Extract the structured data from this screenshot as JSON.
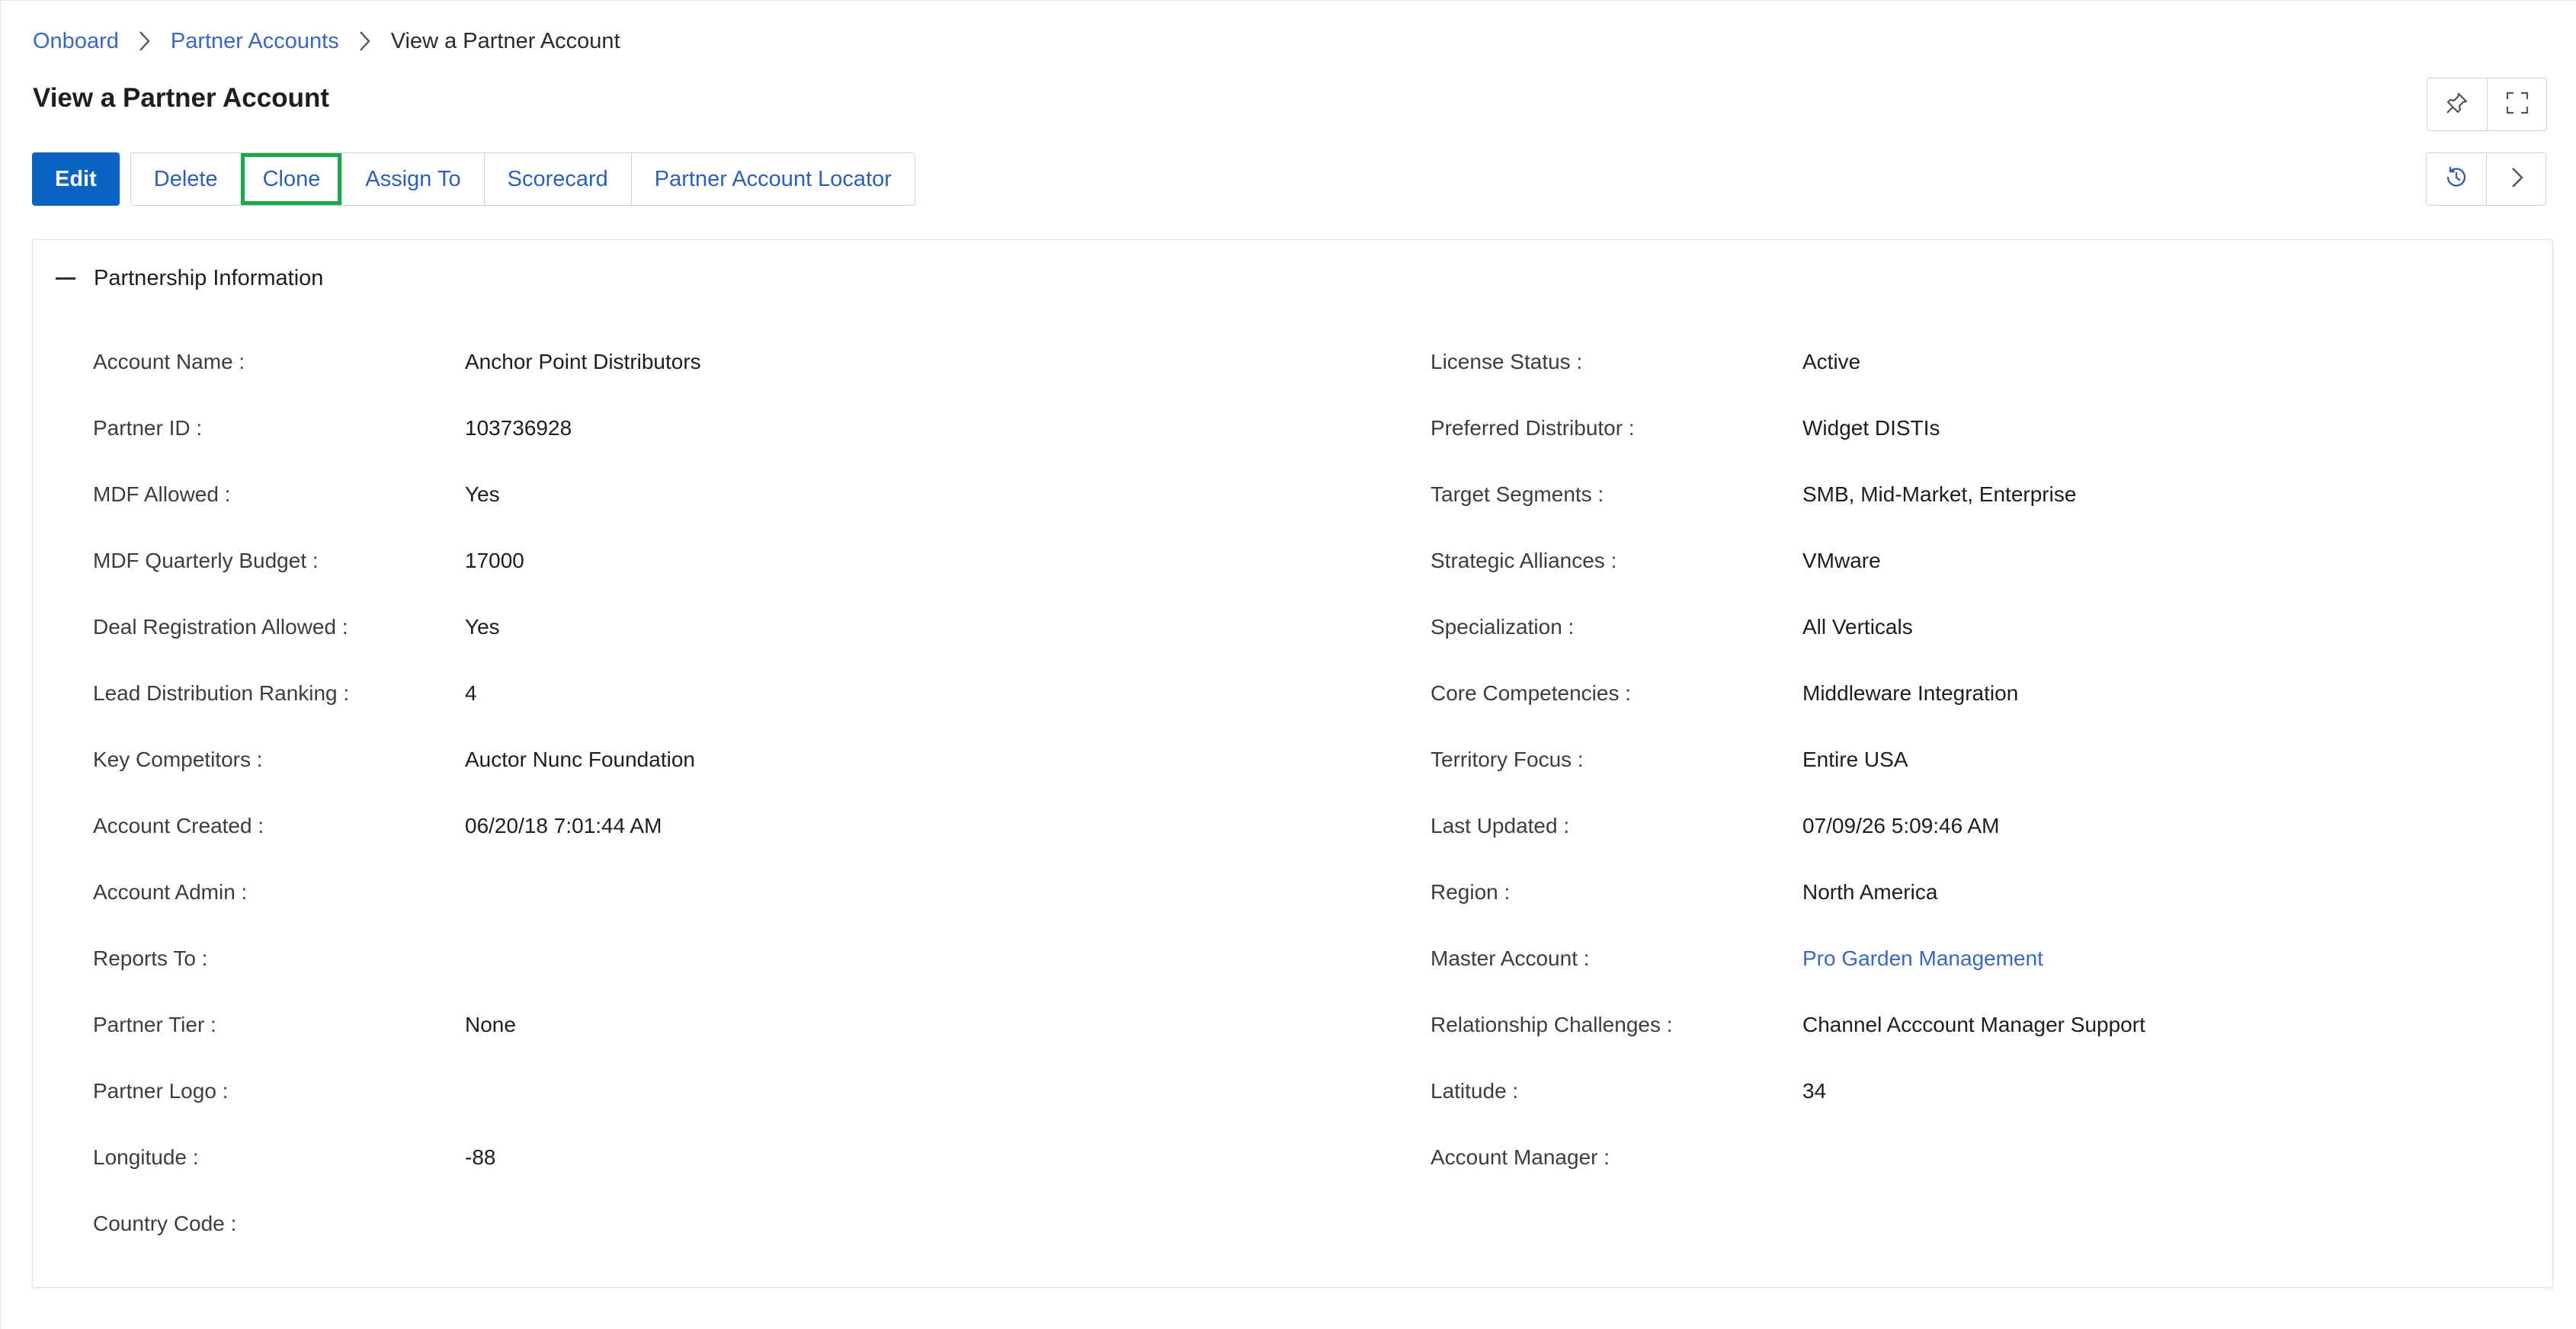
{
  "breadcrumb": {
    "items": [
      "Onboard",
      "Partner Accounts"
    ],
    "current": "View a Partner Account"
  },
  "page_title": "View a Partner Account",
  "header_icons": [
    "pin-icon",
    "fullscreen-icon"
  ],
  "toolbar": {
    "edit_label": "Edit",
    "buttons": [
      "Delete",
      "Clone",
      "Assign To",
      "Scorecard",
      "Partner Account Locator"
    ],
    "highlighted": "Clone",
    "right_icons": [
      "history-icon",
      "chevron-right-icon"
    ]
  },
  "section": {
    "title": "Partnership Information",
    "left_fields": [
      {
        "label": "Account Name :",
        "value": "Anchor Point Distributors"
      },
      {
        "label": "Partner ID :",
        "value": "103736928"
      },
      {
        "label": "MDF Allowed :",
        "value": "Yes"
      },
      {
        "label": "MDF Quarterly Budget :",
        "value": "17000"
      },
      {
        "label": "Deal Registration Allowed :",
        "value": "Yes"
      },
      {
        "label": "Lead Distribution Ranking :",
        "value": "4"
      },
      {
        "label": "Key Competitors :",
        "value": "Auctor Nunc Foundation"
      },
      {
        "label": "Account Created :",
        "value": "06/20/18 7:01:44 AM"
      },
      {
        "label": "Account Admin :",
        "value": ""
      },
      {
        "label": "Reports To :",
        "value": ""
      },
      {
        "label": "Partner Tier :",
        "value": "None"
      },
      {
        "label": "Partner Logo :",
        "value": ""
      },
      {
        "label": "Longitude :",
        "value": "-88"
      },
      {
        "label": "Country Code :",
        "value": ""
      }
    ],
    "right_fields": [
      {
        "label": "License Status :",
        "value": "Active"
      },
      {
        "label": "Preferred Distributor :",
        "value": "Widget DISTIs"
      },
      {
        "label": "Target Segments :",
        "value": "SMB, Mid-Market, Enterprise"
      },
      {
        "label": "Strategic Alliances :",
        "value": "VMware"
      },
      {
        "label": "Specialization :",
        "value": "All Verticals"
      },
      {
        "label": "Core Competencies :",
        "value": "Middleware Integration"
      },
      {
        "label": "Territory Focus :",
        "value": "Entire USA"
      },
      {
        "label": "Last Updated :",
        "value": "07/09/26 5:09:46 AM"
      },
      {
        "label": "Region :",
        "value": "North America"
      },
      {
        "label": "Master Account :",
        "value": "Pro Garden Management",
        "link": true
      },
      {
        "label": "Relationship Challenges :",
        "value": "Channel Acccount Manager Support"
      },
      {
        "label": "Latitude :",
        "value": "34"
      },
      {
        "label": "Account Manager :",
        "value": ""
      }
    ]
  },
  "colors": {
    "primary": "#0b63c4",
    "link": "#3a66c4",
    "highlight": "#1aa94a"
  }
}
